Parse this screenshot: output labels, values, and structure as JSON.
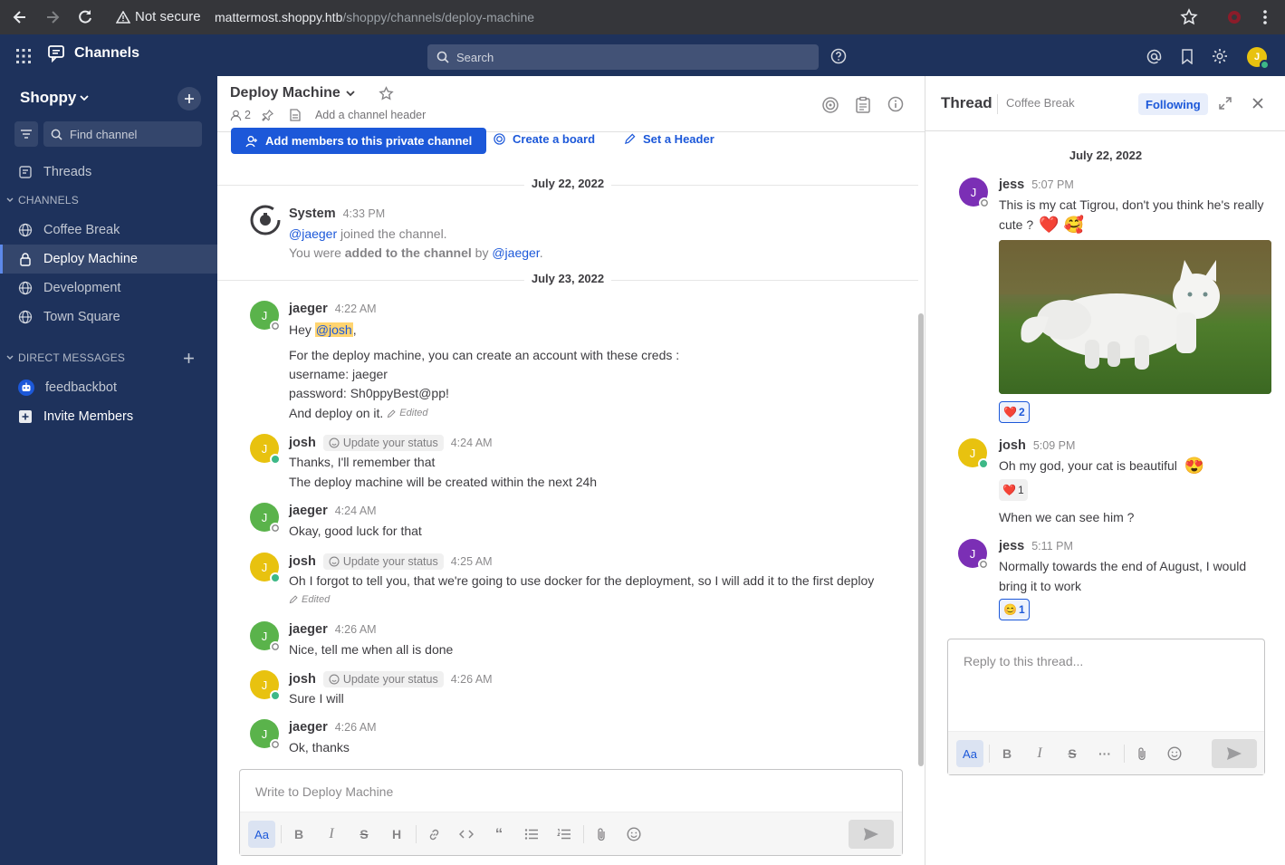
{
  "browser": {
    "security_label": "Not secure",
    "url_host": "mattermost.shoppy.htb",
    "url_path": "/shoppy/channels/deploy-machine"
  },
  "global_header": {
    "product": "Channels",
    "search_placeholder": "Search",
    "avatar_initial": "J"
  },
  "sidebar": {
    "team_name": "Shoppy",
    "find_channel_placeholder": "Find channel",
    "threads_label": "Threads",
    "channels_section": "CHANNELS",
    "channels": [
      {
        "label": "Coffee Break",
        "icon": "globe-icon"
      },
      {
        "label": "Deploy Machine",
        "icon": "lock-icon",
        "active": true
      },
      {
        "label": "Development",
        "icon": "globe-icon"
      },
      {
        "label": "Town Square",
        "icon": "globe-icon"
      }
    ],
    "dm_section": "DIRECT MESSAGES",
    "dms": [
      {
        "label": "feedbackbot",
        "icon": "bot-icon"
      }
    ],
    "invite_label": "Invite Members"
  },
  "channel": {
    "name": "Deploy Machine",
    "member_count": "2",
    "header_placeholder": "Add a channel header",
    "add_members_label": "Add members to this private channel",
    "create_board_label": "Create a board",
    "set_header_label": "Set a Header",
    "date1": "July 22, 2022",
    "date2": "July 23, 2022",
    "system": {
      "name": "System",
      "time": "4:33 PM",
      "line1_mention": "@jaeger",
      "line1_text": "joined the channel.",
      "line2_pre": "You were",
      "line2_bold": "added to the channel",
      "line2_by": "by",
      "line2_mention": "@jaeger"
    },
    "posts": [
      {
        "user": "jaeger",
        "time": "4:22 AM",
        "hey": "Hey",
        "mention": "@josh",
        "lines": [
          "For the deploy machine, you can create an account with these creds :",
          "username: jaeger",
          "password: Sh0ppyBest@pp!",
          "And deploy on it."
        ],
        "edited": "Edited"
      },
      {
        "user": "josh",
        "status": "Update your status",
        "time": "4:24 AM",
        "lines": [
          "Thanks, I'll remember that",
          "The deploy machine will be created within the next 24h"
        ]
      },
      {
        "user": "jaeger",
        "time": "4:24 AM",
        "lines": [
          "Okay, good luck for that"
        ]
      },
      {
        "user": "josh",
        "status": "Update your status",
        "time": "4:25 AM",
        "lines": [
          "Oh I forgot to tell you, that we're going to use docker for the deployment, so I will add it to the first deploy"
        ],
        "edited": "Edited"
      },
      {
        "user": "jaeger",
        "time": "4:26 AM",
        "lines": [
          "Nice, tell me when all is done"
        ]
      },
      {
        "user": "josh",
        "status": "Update your status",
        "time": "4:26 AM",
        "lines": [
          "Sure I will"
        ]
      },
      {
        "user": "jaeger",
        "time": "4:26 AM",
        "lines": [
          "Ok, thanks"
        ]
      }
    ],
    "composer_placeholder": "Write to Deploy Machine"
  },
  "thread": {
    "title": "Thread",
    "channel": "Coffee Break",
    "following_label": "Following",
    "date": "July 22, 2022",
    "posts": [
      {
        "user": "jess",
        "time": "5:07 PM",
        "lines": [
          "This is my cat Tigrou, don't you think he's really",
          "cute ?"
        ],
        "emoji": "❤️ 🥰",
        "reaction": {
          "emoji": "❤️",
          "count": "2"
        }
      },
      {
        "user": "josh",
        "time": "5:09 PM",
        "lines": [
          "Oh my god, your cat is beautiful"
        ],
        "emoji": "😍",
        "reaction": {
          "emoji": "❤️",
          "count": "1"
        },
        "followup": "When we can see him ?"
      },
      {
        "user": "jess",
        "time": "5:11 PM",
        "lines": [
          "Normally towards the end of August, I would",
          "bring it to work"
        ],
        "reaction": {
          "emoji": "😊",
          "count": "1"
        }
      }
    ],
    "reply_placeholder": "Reply to this thread..."
  },
  "colors": {
    "sidebar_bg": "#1e325c",
    "accent": "#1c58d9",
    "jaeger_avatar": "#5ab34b",
    "josh_avatar": "#e8c20f",
    "jess_avatar": "#7b2fb5",
    "online": "#3db887"
  }
}
